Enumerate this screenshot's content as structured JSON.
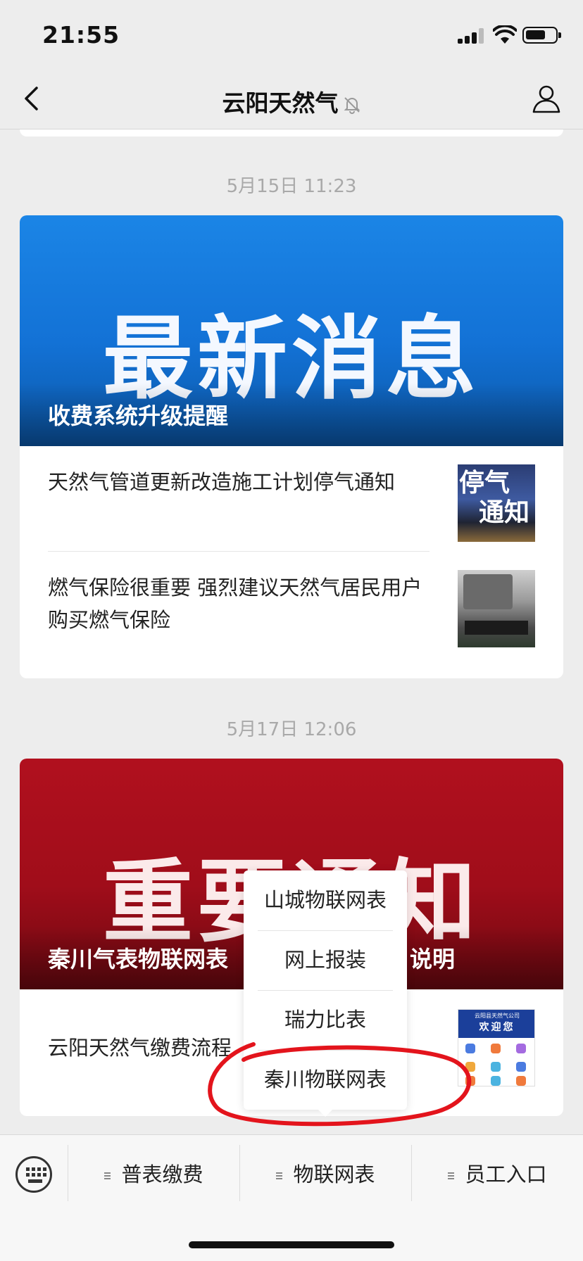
{
  "status_bar": {
    "time": "21:55"
  },
  "nav": {
    "title": "云阳天然气"
  },
  "messages": [
    {
      "date": "5月15日 11:23",
      "banner_text": "最新消息",
      "caption": "收费系统升级提醒",
      "items": [
        {
          "title": "天然气管道更新改造施工计划停气通知",
          "thumb_text": [
            "停气",
            "通知"
          ]
        },
        {
          "title": "燃气保险很重要   强烈建议天然气居民用户购买燃气保险"
        }
      ]
    },
    {
      "date": "5月17日 12:06",
      "banner_text": "重要通知",
      "caption": "秦川气表物联网表",
      "caption_tail": "说明",
      "items": [
        {
          "title": "云阳天然气缴费流程",
          "thumb_header_small": "云阳县天然气公司",
          "thumb_header_big": "欢迎您"
        }
      ]
    }
  ],
  "popup_menu": {
    "items": [
      "山城物联网表",
      "网上报装",
      "瑞力比表",
      "秦川物联网表"
    ]
  },
  "bottom_menu": {
    "tabs": [
      "普表缴费",
      "物联网表",
      "员工入口"
    ]
  },
  "colors": {
    "banner_blue": "#1372d6",
    "banner_red": "#a00d1a",
    "annotation_red": "#e3141c",
    "background": "#ededed"
  },
  "icons": [
    "back-icon",
    "mute-bell-icon",
    "profile-icon",
    "keyboard-icon",
    "menu-lines-icon"
  ]
}
